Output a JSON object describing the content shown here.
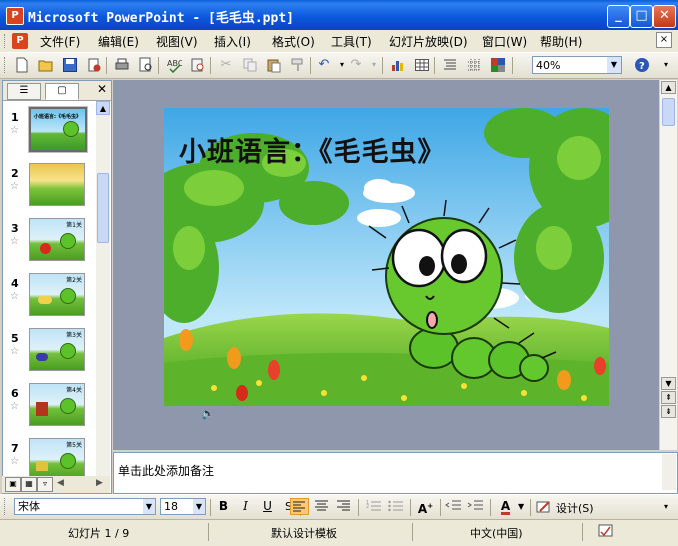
{
  "window": {
    "app_icon_glyph": "P",
    "title": "Microsoft PowerPoint - [毛毛虫.ppt]",
    "minimize": "_",
    "maximize": "□",
    "close": "✕"
  },
  "menu": {
    "items": [
      "文件(F)",
      "编辑(E)",
      "视图(V)",
      "插入(I)",
      "格式(O)",
      "工具(T)",
      "幻灯片放映(D)",
      "窗口(W)",
      "帮助(H)"
    ],
    "help_box_close": "×"
  },
  "toolbar": {
    "zoom_value": "40%",
    "icons": [
      "new-icon",
      "open-icon",
      "save-icon",
      "permission-icon",
      "print-icon",
      "print-preview-icon",
      "spelling-icon",
      "research-icon",
      "cut-icon",
      "copy-icon",
      "paste-icon",
      "format-painter-icon",
      "undo-icon",
      "redo-icon",
      "insert-chart-icon",
      "insert-table-icon",
      "expand-all-icon",
      "show-grid-icon",
      "color-grayscale-icon",
      "help-icon"
    ]
  },
  "left_pane": {
    "tab_outline": "☰",
    "tab_slides": "▢",
    "close": "✕",
    "thumbnails": [
      {
        "number": "1",
        "label": ""
      },
      {
        "number": "2",
        "label": ""
      },
      {
        "number": "3",
        "label": "第1关"
      },
      {
        "number": "4",
        "label": "第2关"
      },
      {
        "number": "5",
        "label": "第3关"
      },
      {
        "number": "6",
        "label": "第4关"
      },
      {
        "number": "7",
        "label": "第5关"
      }
    ]
  },
  "slide": {
    "title": "小班语言：《毛毛虫》"
  },
  "notes": {
    "placeholder": "单击此处添加备注"
  },
  "format_toolbar": {
    "font_name": "宋体",
    "font_size": "18",
    "bold": "B",
    "italic": "I",
    "underline": "U",
    "design_label": "设计(S)"
  },
  "status_bar": {
    "slide_counter": "幻灯片 1 / 9",
    "template": "默认设计模板",
    "language": "中文(中国)"
  },
  "colors": {
    "titlebar": "#0a5fd8",
    "slide_area": "#8f97ad",
    "accent_active": "#ffc870"
  }
}
